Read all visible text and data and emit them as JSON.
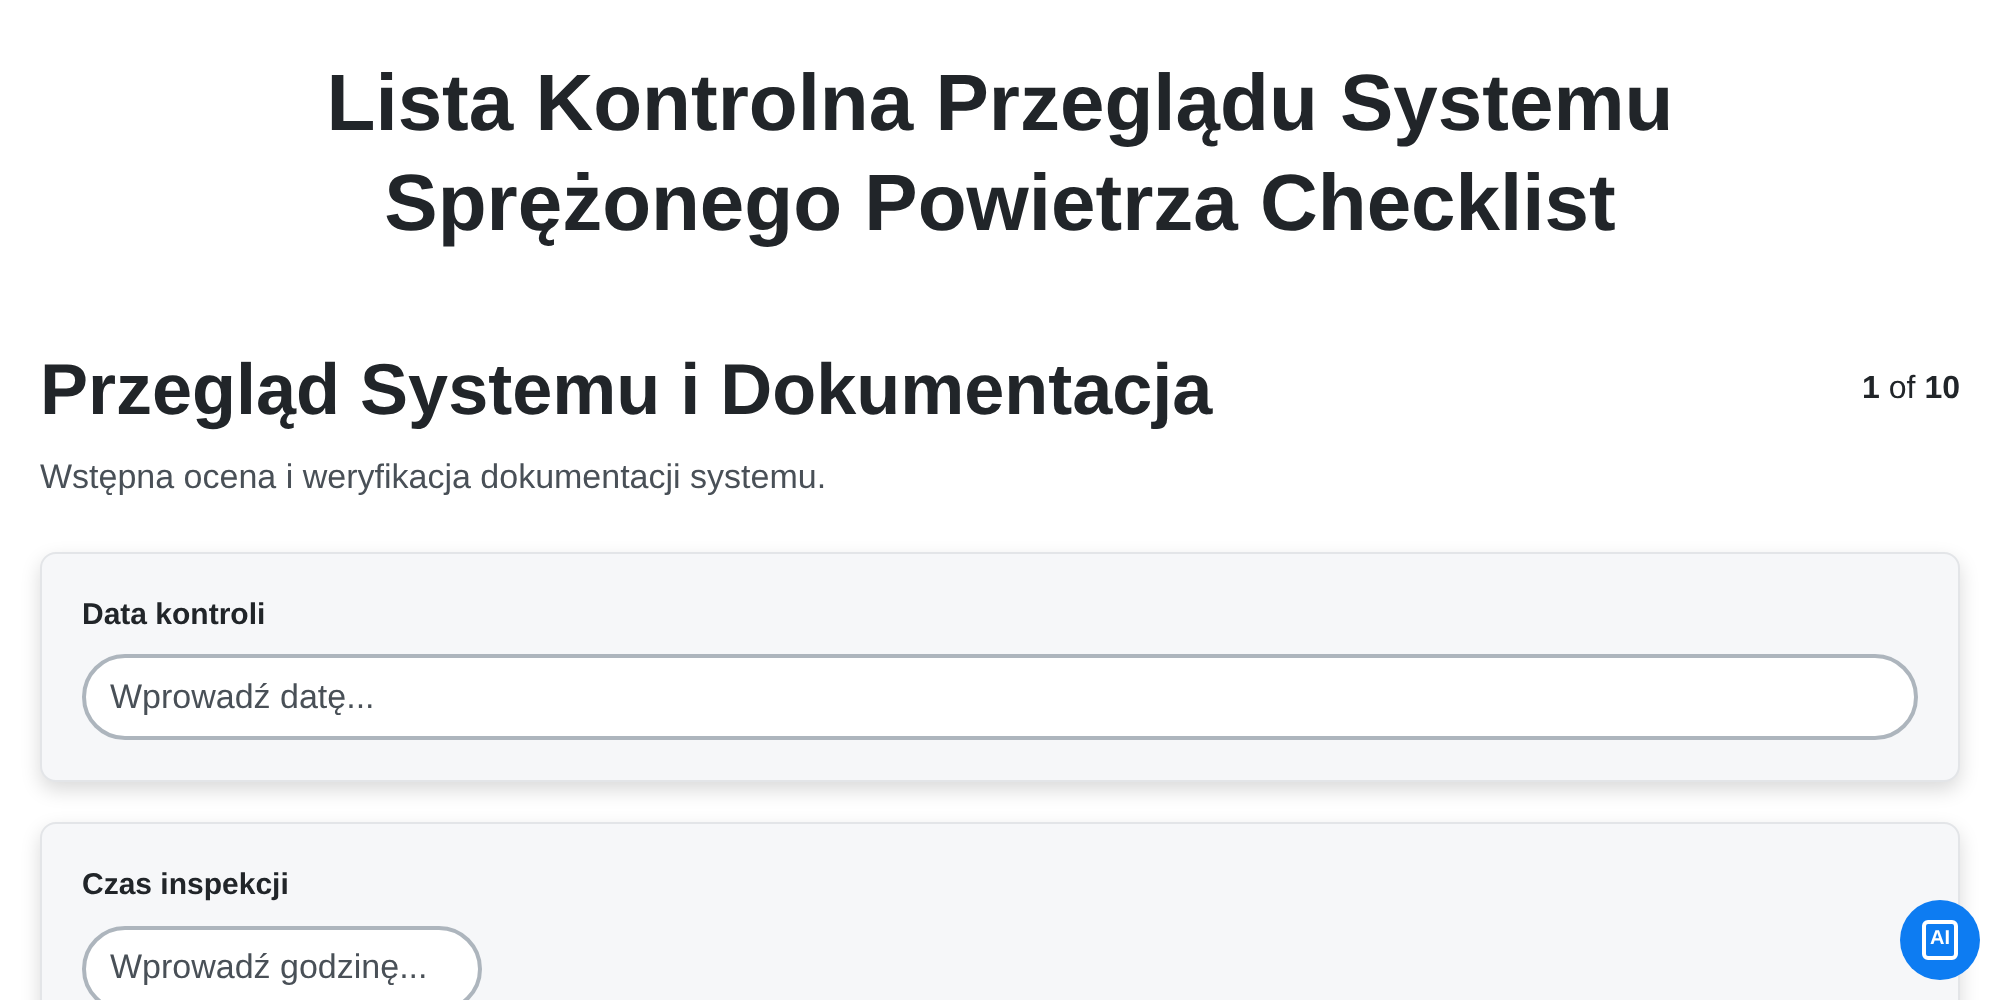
{
  "title": "Lista Kontrolna Przeglądu Systemu Sprężonego Powietrza Checklist",
  "section": {
    "heading": "Przegląd Systemu i Dokumentacja",
    "page_current": "1",
    "page_of": "of",
    "page_total": "10",
    "description": "Wstępna ocena i weryfikacja dokumentacji systemu."
  },
  "fields": [
    {
      "label": "Data kontroli",
      "kind": "date",
      "placeholder": "Wprowadź datę..."
    },
    {
      "label": "Czas inspekcji",
      "kind": "time",
      "placeholder": "Wprowadź godzinę..."
    }
  ],
  "ai_button": {
    "label": "AI"
  }
}
